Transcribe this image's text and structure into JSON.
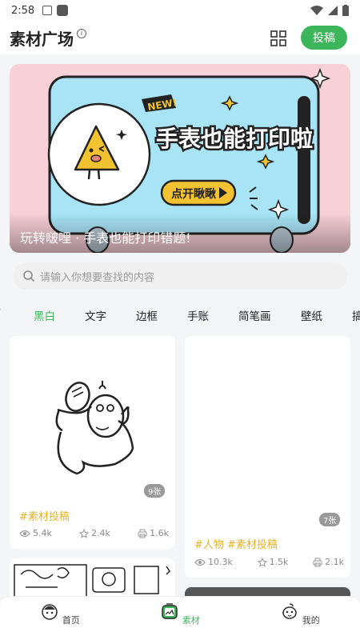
{
  "status": {
    "time": "2:58"
  },
  "header": {
    "title": "素材广场",
    "submit_label": "投稿"
  },
  "banner": {
    "headline": "手表也能打印啦",
    "badge": "NEW!",
    "cta": "点开瞅瞅",
    "caption": "玩转啵哩 · 手表也能打印错题!"
  },
  "search": {
    "placeholder": "请输入你想要查找的内容"
  },
  "tabs": [
    {
      "label": "黑白",
      "active": true
    },
    {
      "label": "文字",
      "active": false
    },
    {
      "label": "边框",
      "active": false
    },
    {
      "label": "手账",
      "active": false
    },
    {
      "label": "简笔画",
      "active": false
    },
    {
      "label": "壁纸",
      "active": false
    },
    {
      "label": "搞",
      "active": false
    }
  ],
  "cards": [
    {
      "count": "9张",
      "tags": "#素材投稿",
      "views": "5.4k",
      "likes": "2.4k",
      "prints": "1.6k"
    },
    {
      "count": "7张",
      "tags": "#人物  #素材投稿",
      "views": "10.3k",
      "likes": "1.5k",
      "prints": "2.1k"
    }
  ],
  "nav": [
    {
      "label": "首页",
      "icon": "home-face-icon"
    },
    {
      "label": "素材",
      "icon": "material-icon",
      "active": true
    },
    {
      "label": "我的",
      "icon": "profile-face-icon"
    }
  ],
  "colors": {
    "accent": "#3db65b",
    "tag": "#e6b325",
    "banner_bg": "#f8d0d8",
    "screen_bg": "#a8e4f6"
  }
}
